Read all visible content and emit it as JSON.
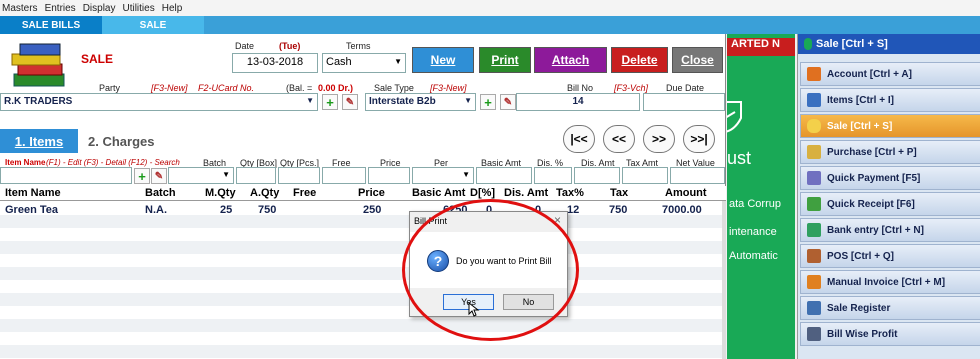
{
  "menu": [
    "Masters",
    "Entries",
    "Display",
    "Utilities",
    "Help"
  ],
  "tabs": [
    "SALE BILLS",
    "SALE"
  ],
  "form": {
    "title": "SALE",
    "date_label": "Date",
    "day": "(Tue)",
    "terms_label": "Terms",
    "date_value": "13-03-2018",
    "terms_value": "Cash",
    "party_label": "Party",
    "f3_new": "[F3-New]",
    "f2_ucard": "F2-UCard No.",
    "bal_label": "(Bal. =",
    "bal_value": "0.00 Dr.)",
    "sale_type_label": "Sale Type",
    "sale_type_hint": "[F3-New]",
    "bill_no_label": "Bill No",
    "vch_hint": "[F3-Vch]",
    "due_date_label": "Due Date",
    "party_value": "R.K TRADERS",
    "sale_type_value": "Interstate B2b",
    "bill_no_value": "14"
  },
  "buttons": {
    "new": "New",
    "print": "Print",
    "attach": "Attach",
    "delete": "Delete",
    "close": "Close"
  },
  "section_tabs": {
    "items": "1. Items",
    "charges": "2. Charges"
  },
  "nav": {
    "first": "|<<",
    "prev": "<<",
    "next": ">>",
    "last": ">>|"
  },
  "entry_labels": {
    "item_name": "Item Name",
    "hints": "(F1) - Edit  (F3) - Detail  (F12) - Search",
    "batch": "Batch",
    "qty_box": "Qty [Box]",
    "qty_pcs": "Qty [Pcs.]",
    "free": "Free",
    "price": "Price",
    "per": "Per",
    "basic_amt": "Basic Amt",
    "dis_pct": "Dis. %",
    "dis_amt": "Dis. Amt",
    "tax_amt": "Tax Amt",
    "net_value": "Net Value"
  },
  "grid": {
    "headers": [
      "Item Name",
      "Batch",
      "M.Qty",
      "A.Qty",
      "Free",
      "Price",
      "Basic Amt",
      "D[%]",
      "Dis. Amt",
      "Tax%",
      "Tax",
      "Amount"
    ],
    "rows": [
      [
        "Green Tea",
        "N.A.",
        "25",
        "750",
        "",
        "250",
        "6250",
        "0",
        "0",
        "12",
        "750",
        "7000.00"
      ]
    ]
  },
  "dialog": {
    "title": "Bill Print",
    "message": "Do you want to Print Bill",
    "yes": "Yes",
    "no": "No",
    "close": "×"
  },
  "green_panel": {
    "banner": "ARTED N",
    "text1": "ust",
    "text2": "ata Corrup",
    "text3": "intenance",
    "text4": "Automatic"
  },
  "sidebar": {
    "header": "Sale [Ctrl + S]",
    "items": [
      {
        "label": "Account [Ctrl + A]",
        "color": "#e07020"
      },
      {
        "label": "Items [Ctrl + I]",
        "color": "#3a70c0"
      },
      {
        "label": "Sale [Ctrl + S]",
        "color": "#e8a030"
      },
      {
        "label": "Purchase [Ctrl + P]",
        "color": "#d8b040"
      },
      {
        "label": "Quick Payment [F5]",
        "color": "#7070c0"
      },
      {
        "label": "Quick Receipt [F6]",
        "color": "#40a040"
      },
      {
        "label": "Bank entry [Ctrl + N]",
        "color": "#30a060"
      },
      {
        "label": "POS [Ctrl + Q]",
        "color": "#b06030"
      },
      {
        "label": "Manual Invoice [Ctrl + M]",
        "color": "#e08020"
      },
      {
        "label": "Sale Register",
        "color": "#4070b0"
      },
      {
        "label": "Bill Wise Profit",
        "color": "#506080"
      }
    ]
  }
}
